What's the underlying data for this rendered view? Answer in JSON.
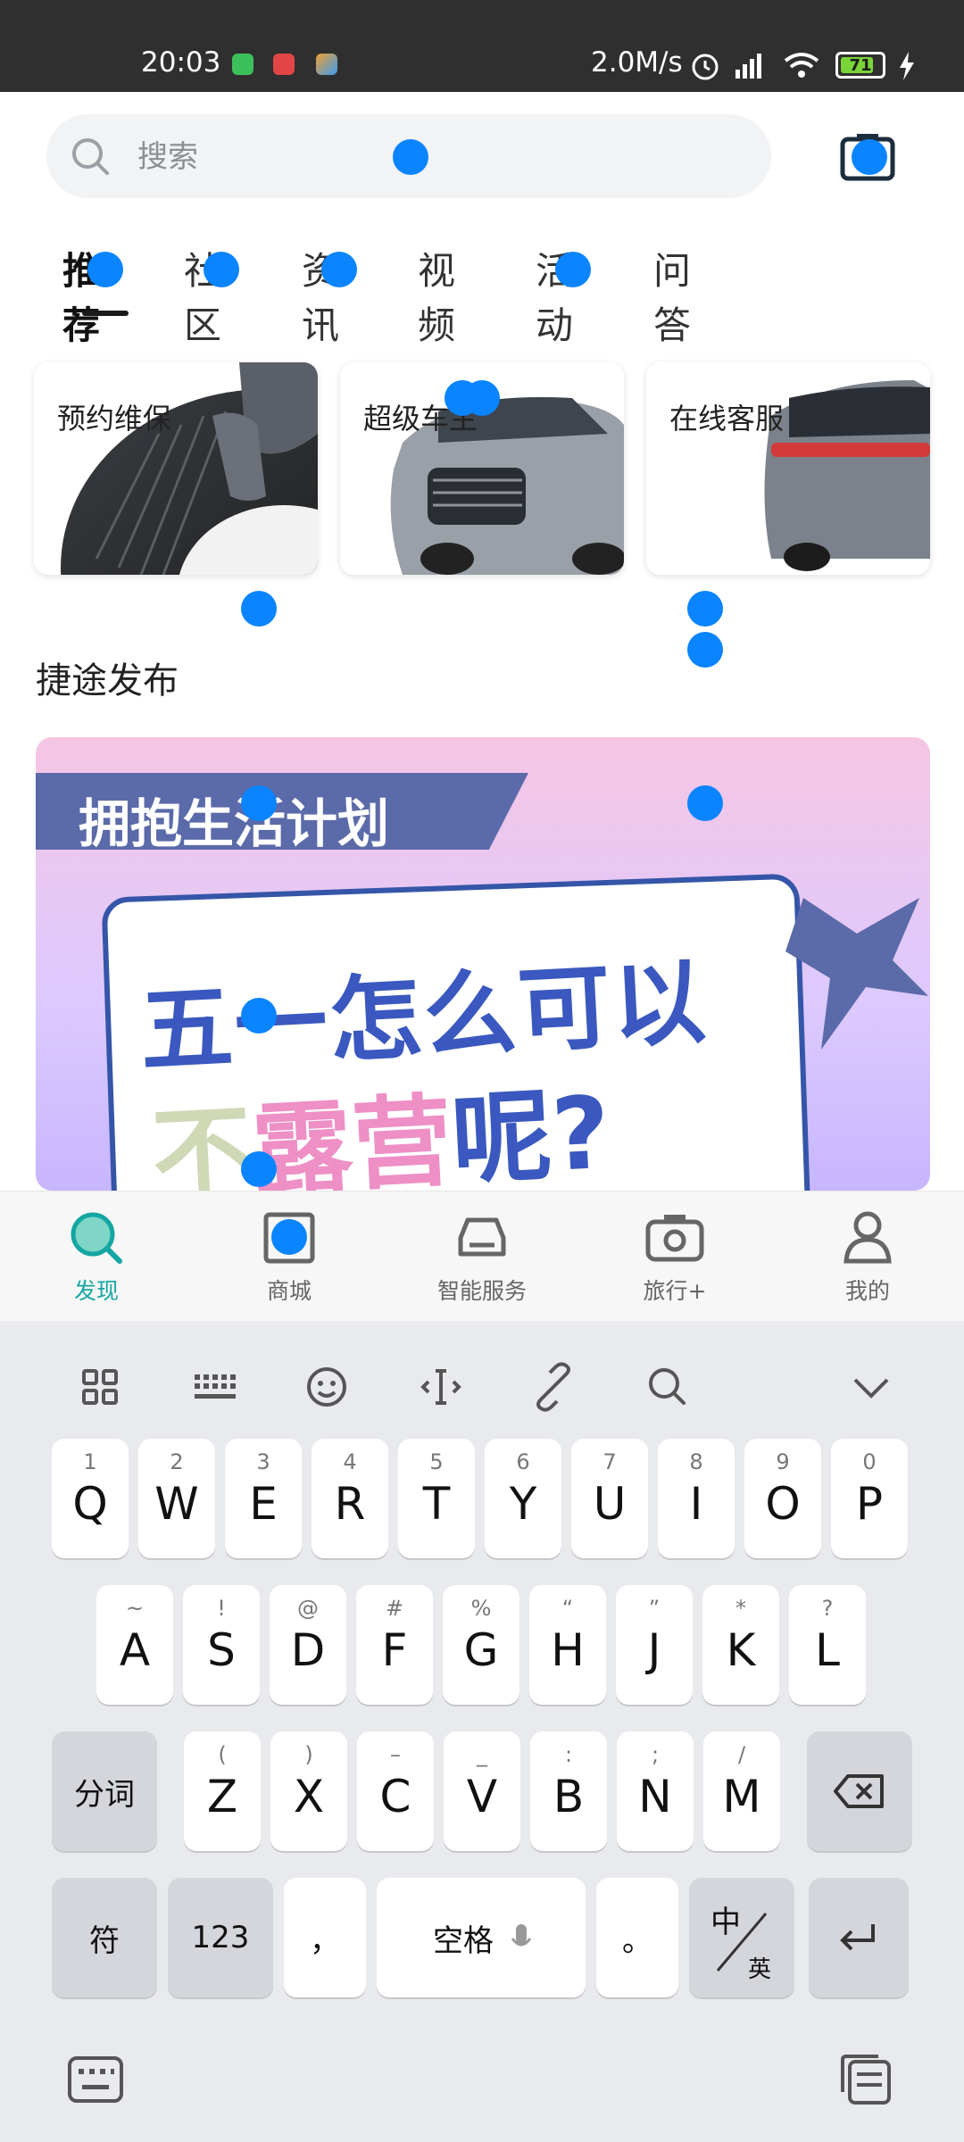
{
  "status": {
    "time": "20:03",
    "speed": "2.0M/s",
    "battery": "71",
    "colors": {
      "bar": "#2f2f2f",
      "battery": "#7bd33a"
    }
  },
  "search": {
    "placeholder": "搜索"
  },
  "tabs": [
    "推荐",
    "社区",
    "资讯",
    "视频",
    "活动",
    "问答"
  ],
  "services": [
    {
      "label": "预约维保"
    },
    {
      "label": "超级车主"
    },
    {
      "label": "在线客服"
    }
  ],
  "section_title": "捷途发布",
  "banner": {
    "ribbon": "拥抱生活计划",
    "line1": "五一怎么可以",
    "line2_a": "不",
    "line2_b": "露营",
    "line2_c": "呢?"
  },
  "bottom_nav": [
    {
      "label": "发现",
      "icon": "magnifier-icon",
      "active": true
    },
    {
      "label": "商城",
      "icon": "store-icon"
    },
    {
      "label": "智能服务",
      "icon": "car-icon"
    },
    {
      "label": "旅行+",
      "icon": "camera-icon"
    },
    {
      "label": "我的",
      "icon": "person-icon"
    }
  ],
  "keyboard": {
    "row1": [
      {
        "main": "Q",
        "sub": "1"
      },
      {
        "main": "W",
        "sub": "2"
      },
      {
        "main": "E",
        "sub": "3"
      },
      {
        "main": "R",
        "sub": "4"
      },
      {
        "main": "T",
        "sub": "5"
      },
      {
        "main": "Y",
        "sub": "6"
      },
      {
        "main": "U",
        "sub": "7"
      },
      {
        "main": "I",
        "sub": "8"
      },
      {
        "main": "O",
        "sub": "9"
      },
      {
        "main": "P",
        "sub": "0"
      }
    ],
    "row2": [
      {
        "main": "A",
        "sub": "~"
      },
      {
        "main": "S",
        "sub": "!"
      },
      {
        "main": "D",
        "sub": "@"
      },
      {
        "main": "F",
        "sub": "#"
      },
      {
        "main": "G",
        "sub": "%"
      },
      {
        "main": "H",
        "sub": "“"
      },
      {
        "main": "J",
        "sub": "”"
      },
      {
        "main": "K",
        "sub": "*"
      },
      {
        "main": "L",
        "sub": "?"
      }
    ],
    "row3": [
      {
        "main": "Z",
        "sub": "("
      },
      {
        "main": "X",
        "sub": ")"
      },
      {
        "main": "C",
        "sub": "–"
      },
      {
        "main": "V",
        "sub": "_"
      },
      {
        "main": "B",
        "sub": ":"
      },
      {
        "main": "N",
        "sub": ";"
      },
      {
        "main": "M",
        "sub": "/"
      }
    ],
    "seg": "分词",
    "sym": "符",
    "num": "123",
    "comma": "，",
    "space": "空格",
    "period": "。",
    "lang_top": "中",
    "lang_bottom": "英"
  },
  "accent": "#15a6a3",
  "dot_color": "#0a84ff"
}
